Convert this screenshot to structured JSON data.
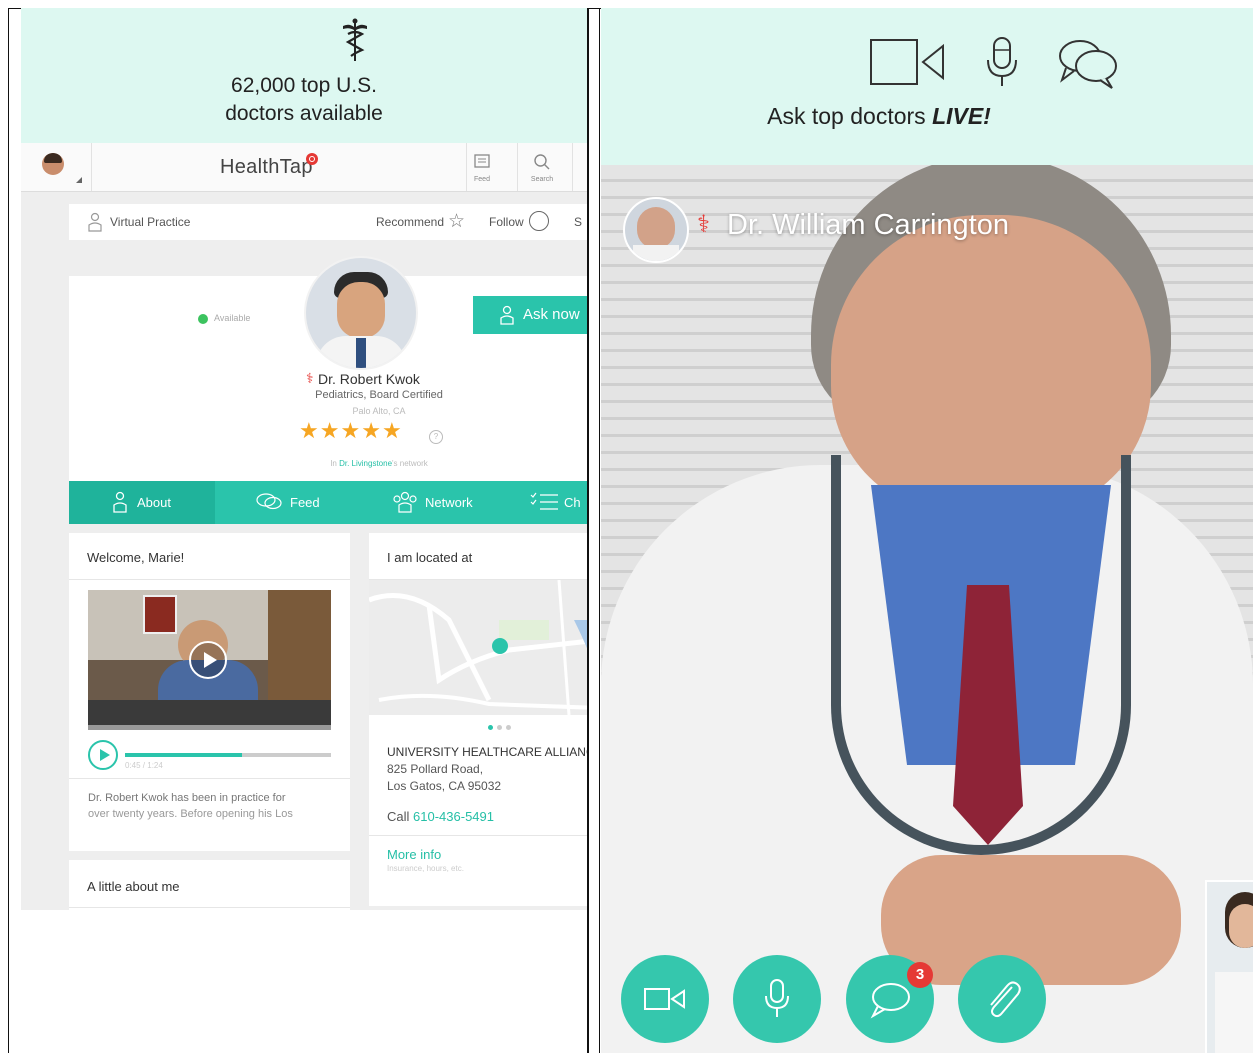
{
  "left": {
    "banner_title_line1": "62,000 top U.S.",
    "banner_title_line2": "doctors available",
    "app": {
      "logo": "HealthTap",
      "header_icons": [
        {
          "icon": "feed-icon",
          "label": "Feed"
        },
        {
          "icon": "search-icon",
          "label": "Search"
        }
      ],
      "virtual_practice_label": "Virtual Practice",
      "recommend_label": "Recommend",
      "follow_label": "Follow",
      "share_label_partial": "S",
      "availability": "Available",
      "ask_now_label": "Ask now",
      "doctor_name": "Dr. Robert Kwok",
      "doctor_specialty": "Pediatrics, Board Certified",
      "doctor_location": "Palo Alto, CA",
      "rating_stars": 5,
      "network_prefix": "In",
      "network_name": "Dr. Livingstone",
      "network_suffix": "'s network",
      "tabs": [
        {
          "label": "About",
          "icon": "about-icon",
          "active": true
        },
        {
          "label": "Feed",
          "icon": "feed-bubble-icon",
          "active": false
        },
        {
          "label": "Network",
          "icon": "network-icon",
          "active": false
        },
        {
          "label": "Ch",
          "icon": "checklist-icon",
          "active": false
        }
      ],
      "welcome_card": {
        "title": "Welcome, Marie!",
        "audio_time": "0:45 / 1:24",
        "audio_progress": 0.57,
        "bio_line1": "Dr. Robert Kwok has been in practice for",
        "bio_line2": "over twenty years.  Before opening his Los"
      },
      "location_card": {
        "title": "I am located at",
        "practice_name": "UNIVERSITY HEALTHCARE ALLIANC",
        "address_line1": "825 Pollard Road,",
        "address_line2": "Los Gatos, CA 95032",
        "call_prefix": "Call",
        "phone": "610-436-5491",
        "more_info": "More info",
        "more_info_sub": "Insurance, hours, etc."
      },
      "about_card_title": "A little about me"
    }
  },
  "right": {
    "banner_title_plain": "Ask top doctors ",
    "banner_title_emph": "LIVE!",
    "banner_icons": [
      "video-camera-icon",
      "microphone-icon",
      "chat-bubbles-icon"
    ],
    "doctor_name": "Dr. William Carrington",
    "controls": [
      {
        "name": "video-button",
        "icon": "video-camera-icon"
      },
      {
        "name": "microphone-button",
        "icon": "microphone-icon"
      },
      {
        "name": "chat-button",
        "icon": "chat-icon",
        "badge": "3"
      },
      {
        "name": "attachment-button",
        "icon": "paperclip-icon"
      }
    ]
  },
  "colors": {
    "banner_bg": "#ddf8f1",
    "teal": "#2ac4ab",
    "badge_red": "#e53935"
  }
}
